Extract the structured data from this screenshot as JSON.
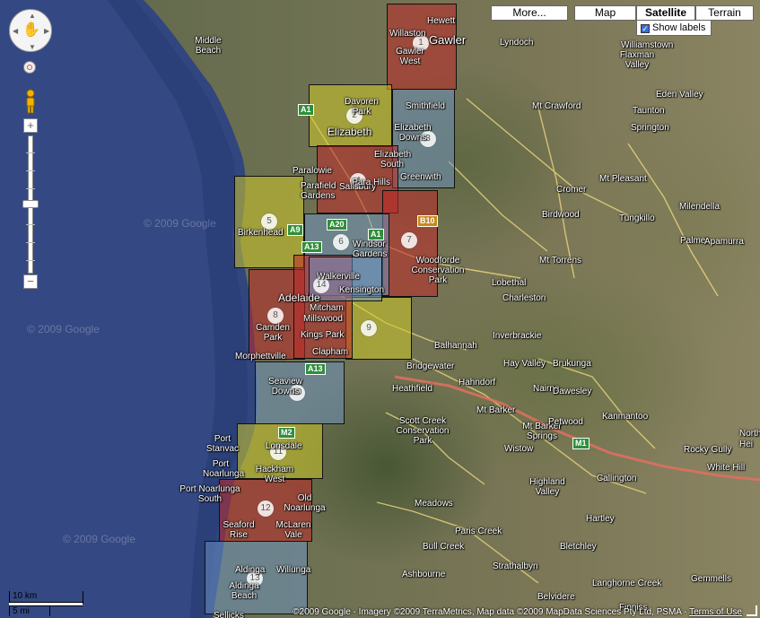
{
  "map_type_buttons": [
    {
      "label": "More..."
    },
    {
      "label": "Map"
    },
    {
      "label": "Satellite",
      "active": true
    },
    {
      "label": "Terrain"
    }
  ],
  "show_labels": {
    "label": "Show labels",
    "checked": true
  },
  "scale": {
    "metric": "10 km",
    "imperial": "5 mi"
  },
  "copyright": {
    "text": "©2009 Google - Imagery ©2009 TerraMetrics, Map data ©2009 MapData Sciences Pty Ltd, PSMA - ",
    "terms": "Terms of Use"
  },
  "watermark": "© 2009 Google",
  "region_colors": {
    "red": "#be2828",
    "yellow": "#cdc828",
    "blue": "#6e96c8"
  },
  "regions": [
    {
      "number": "1",
      "color": "red"
    },
    {
      "number": "2",
      "color": "yellow"
    },
    {
      "number": "3",
      "color": "blue"
    },
    {
      "number": "4",
      "color": "red"
    },
    {
      "number": "5",
      "color": "yellow"
    },
    {
      "number": "6",
      "color": "blue"
    },
    {
      "number": "7",
      "color": "red"
    },
    {
      "number": "8",
      "color": "red"
    },
    {
      "number": "9",
      "color": "yellow"
    },
    {
      "number": "10",
      "color": "blue"
    },
    {
      "number": "11",
      "color": "yellow"
    },
    {
      "number": "12",
      "color": "red"
    },
    {
      "number": "13",
      "color": "blue"
    },
    {
      "number": "14",
      "color": "blue"
    }
  ],
  "places": [
    "Hewett",
    "Willaston",
    "Gawler",
    "Gawler West",
    "Lyndoch",
    "Middle Beach",
    "Davoren Park",
    "Elizabeth",
    "Smithfield",
    "Elizabeth Downs",
    "Paralowie",
    "Elizabeth South",
    "Parafield Gardens",
    "Salisbury",
    "Para Hills",
    "Greenwith",
    "Birkenhead",
    "Windsor Gardens",
    "Woodforde Conservation Park",
    "Walkerville",
    "Adelaide",
    "Kensington",
    "Camden Park",
    "Mitcham",
    "Millswood",
    "Kings Park",
    "Clapham",
    "Morphettville",
    "Seaview Downs",
    "Port Stanvac",
    "Port Noarlunga",
    "Lonsdale",
    "Hackham West",
    "Port Noarlunga South",
    "Old Noarlunga",
    "Seaford Rise",
    "McLaren Vale",
    "Aldinga",
    "Willunga",
    "Aldinga Beach",
    "Sellicks",
    "Williamstown",
    "Mt Crawford",
    "Taunton",
    "Springton",
    "Eden Valley",
    "Flaxman Valley",
    "Mt Pleasant",
    "Cromer",
    "Tungkillo",
    "Milendella",
    "Birdwood",
    "Palmer",
    "Apamurra",
    "Mt Torrens",
    "Lobethal",
    "Charleston",
    "Inverbrackie",
    "Balhannah",
    "Hay Valley",
    "Brukunga",
    "Bridgewater",
    "Hahndorf",
    "Heathfield",
    "Nairne",
    "Dawesley",
    "Mt Barker",
    "Scott Creek Conservation Park",
    "Mt Barker Springs",
    "Petwood",
    "Kanmantoo",
    "Wistow",
    "Highland Valley",
    "Rocky Gully",
    "White Hill",
    "North",
    "Hei",
    "Callington",
    "Hartley",
    "Meadows",
    "Paris Creek",
    "Bull Creek",
    "Strathalbyn",
    "Bletchley",
    "Langhorne Creek",
    "Ashbourne",
    "Belvidere",
    "Gemmells",
    "Finniss"
  ],
  "route_shields": [
    "A1",
    "A20",
    "A13",
    "A9",
    "A1",
    "B10",
    "A13",
    "M2",
    "M1"
  ]
}
